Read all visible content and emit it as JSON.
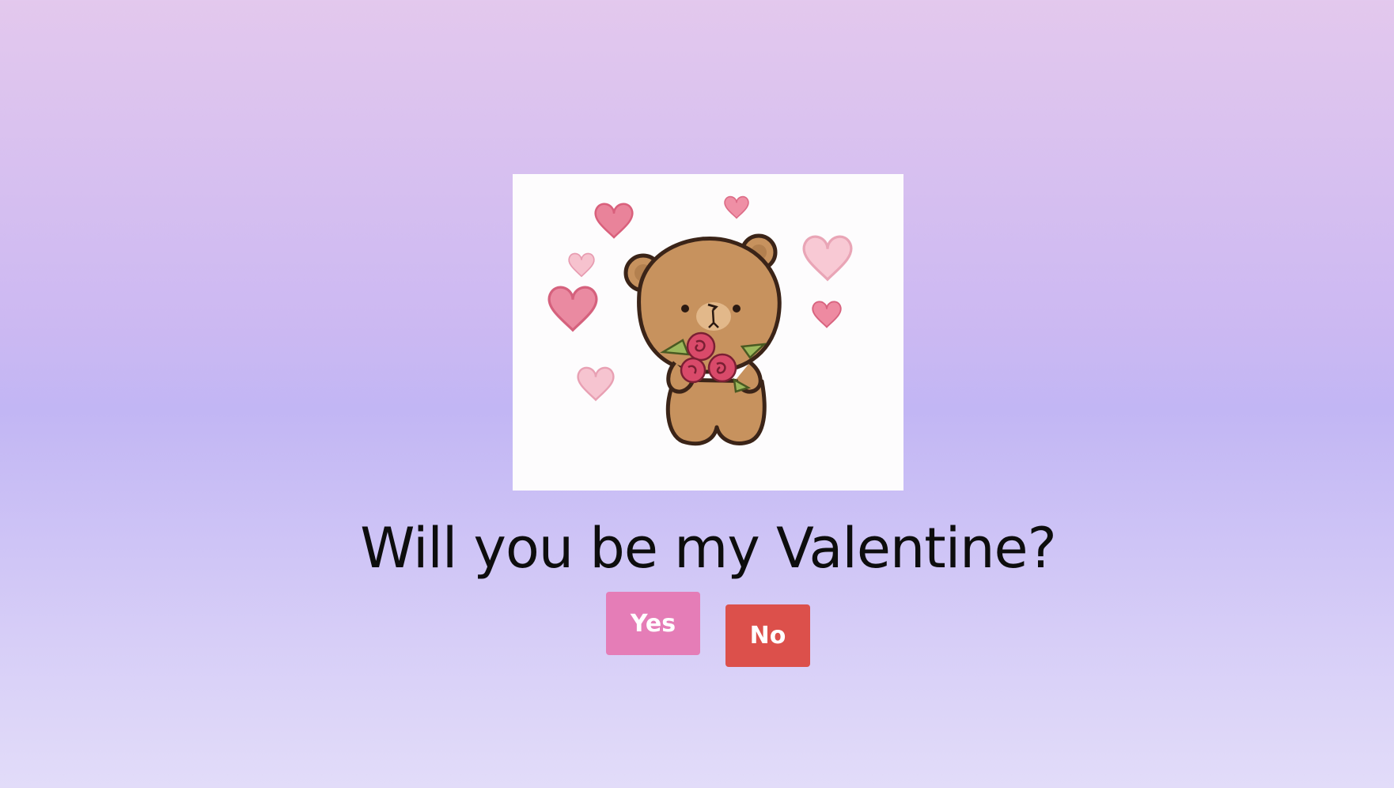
{
  "image": {
    "alt": "",
    "icon": "bear-with-roses-and-hearts"
  },
  "question": "Will you be my Valentine?",
  "buttons": {
    "yes_label": "Yes",
    "no_label": "No"
  },
  "colors": {
    "yes_button": "#e57db7",
    "no_button": "#dc504b",
    "text": "#0d0d0d"
  }
}
